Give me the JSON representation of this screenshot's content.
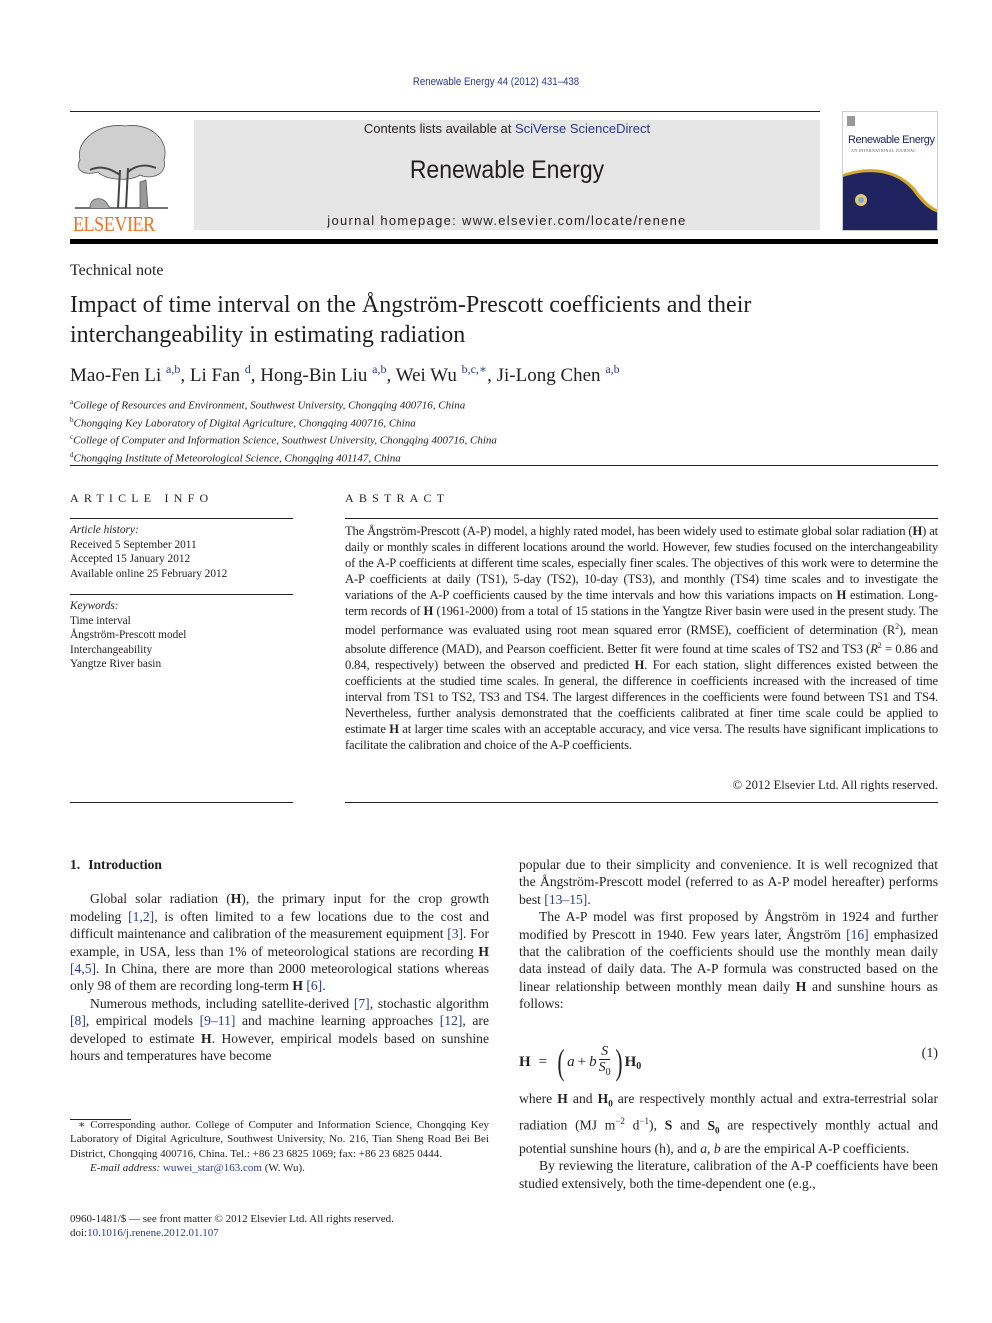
{
  "header": {
    "citation": "Renewable Energy 44 (2012) 431–438",
    "contents_prefix": "Contents lists available at ",
    "contents_link": "SciVerse ScienceDirect",
    "journal_name": "Renewable Energy",
    "homepage_prefix": "journal homepage: ",
    "homepage_url": "www.elsevier.com/locate/renene",
    "publisher_logo_text": "ELSEVIER",
    "cover_title": "Renewable Energy",
    "cover_subtitle": "AN INTERNATIONAL JOURNAL",
    "colors": {
      "publisher_orange": "#f37021",
      "link_blue": "#2b3a8c",
      "banner_gray": "#e6e6e6",
      "cover_navy": "#1f2460",
      "cover_gold": "#d4a82a"
    }
  },
  "article": {
    "section_type": "Technical note",
    "title": "Impact of time interval on the Ångström-Prescott coefficients and their interchangeability in estimating radiation",
    "authors": [
      {
        "name": "Mao-Fen Li",
        "affil": "a,b",
        "sep": ", "
      },
      {
        "name": "Li Fan",
        "affil": "d",
        "sep": ", "
      },
      {
        "name": "Hong-Bin Liu",
        "affil": "a,b",
        "sep": ", "
      },
      {
        "name": "Wei Wu",
        "affil": "b,c,∗",
        "sep": ", "
      },
      {
        "name": "Ji-Long Chen",
        "affil": "a,b",
        "sep": ""
      }
    ],
    "affiliations": [
      {
        "mark": "a",
        "text": "College of Resources and Environment, Southwest University, Chongqing 400716, China"
      },
      {
        "mark": "b",
        "text": "Chongqing Key Laboratory of Digital Agriculture, Chongqing 400716, China"
      },
      {
        "mark": "c",
        "text": "College of Computer and Information Science, Southwest University, Chongqing 400716, China"
      },
      {
        "mark": "d",
        "text": "Chongqing Institute of Meteorological Science, Chongqing 401147, China"
      }
    ]
  },
  "article_info": {
    "heading": "ARTICLE INFO",
    "history_label": "Article history:",
    "history": [
      "Received 5 September 2011",
      "Accepted 15 January 2012",
      "Available online 25 February 2012"
    ],
    "keywords_label": "Keywords:",
    "keywords": [
      "Time interval",
      "Ångström-Prescott model",
      "Interchangeability",
      "Yangtze River basin"
    ]
  },
  "abstract": {
    "heading": "ABSTRACT",
    "parts": {
      "p1": "The Ångström-Prescott (A-P) model, a highly rated model, has been widely used to estimate global solar radiation (",
      "H": "H",
      "p2": ") at daily or monthly scales in different locations around the world. However, few studies focused on the interchangeability of the A-P coefficients at different time scales, especially finer scales. The objectives of this work were to determine the A-P coefficients at daily (TS1), 5-day (TS2), 10-day (TS3), and monthly (TS4) time scales and to investigate the variations of the A-P coefficients caused by the time intervals and how this variations impacts on ",
      "p3": " estimation. Long-term records of ",
      "p4": " (1961-2000) from a total of 15 stations in the Yangtze River basin were used in the present study. The model performance was evaluated using root mean squared error (RMSE), coefficient of determination (R",
      "sup2": "2",
      "p5": "), mean absolute difference (MAD), and Pearson coefficient. Better fit were found at time scales of TS2 and TS3 (",
      "R": "R",
      "p6": " = 0.86 and 0.84, respectively) between the observed and predicted ",
      "p7": ". For each station, slight differences existed between the coefficients at the studied time scales. In general, the difference in coefficients increased with the increased of time interval from TS1 to TS2, TS3 and TS4. The largest differences in the coefficients were found between TS1 and TS4. Nevertheless, further analysis demonstrated that the coefficients calibrated at finer time scale could be applied to estimate ",
      "p8": " at larger time scales with an acceptable accuracy, and vice versa. The results have significant implications to facilitate the calibration and choice of the A-P coefficients."
    },
    "copyright": "© 2012 Elsevier Ltd. All rights reserved."
  },
  "introduction": {
    "number": "1.",
    "heading": "Introduction",
    "para1": {
      "t1": "Global solar radiation (",
      "H": "H",
      "t2": "), the primary input for the crop growth modeling ",
      "r1": "[1,2]",
      "t3": ", is often limited to a few locations due to the cost and difficult maintenance and calibration of the measurement equipment ",
      "r2": "[3]",
      "t4": ". For example, in USA, less than 1% of meteorological stations are recording ",
      "r3": "[4,5]",
      "t5": ". In China, there are more than 2000 meteorological stations whereas only 98 of them are recording long-term ",
      "r4": "[6]",
      "t6": "."
    },
    "para2": {
      "t1": "Numerous methods, including satellite-derived ",
      "r1": "[7]",
      "t2": ", stochastic algorithm ",
      "r2": "[8]",
      "t3": ", empirical models ",
      "r3": "[9–11]",
      "t4": " and machine learning approaches ",
      "r4": "[12]",
      "t5": ", are developed to estimate ",
      "t6": ". However, empirical models based on sunshine hours and temperatures have become popular due to their simplicity and convenience. It is well recognized that the Ångström-Prescott model (referred to as A-P model hereafter) performs best ",
      "r5": "[13–15]",
      "t7": "."
    },
    "para3": {
      "t1": "The A-P model was first proposed by Ångström in 1924 and further modified by Prescott in 1940. Few years later, Ångström ",
      "r1": "[16]",
      "t2": " emphasized that the calibration of the coefficients should use the monthly mean daily data instead of daily data. The A-P formula was constructed based on the linear relationship between monthly mean daily ",
      "t3": " and sunshine hours as follows:"
    },
    "equation": {
      "lhs": "H",
      "eq": "=",
      "a": "a",
      "plus": "+",
      "b": "b",
      "num": "S",
      "den": "S",
      "den_sub": "0",
      "rhs": "H",
      "rhs_sub": "0",
      "number": "(1)"
    },
    "para4": {
      "t1": "where ",
      "H": "H",
      "t2": " and ",
      "H0": "H",
      "zero": "0",
      "t3": " are respectively monthly actual and extra-terrestrial solar radiation (MJ m",
      "exp1": "−2",
      "t4": " d",
      "exp2": "−1",
      "t5": "), ",
      "S": "S",
      "t6": " and ",
      "S0": "S",
      "t7": " are respectively monthly actual and potential sunshine hours (h), and ",
      "a": "a",
      "comma": ", ",
      "b": "b",
      "t8": " are the empirical A-P coefficients."
    },
    "para5": "By reviewing the literature, calibration of the A-P coefficients have been studied extensively, both the time-dependent one (e.g.,"
  },
  "footnote": {
    "text": "∗ Corresponding author. College of Computer and Information Science, Chongqing Key Laboratory of Digital Agriculture, Southwest University, No. 216, Tian Sheng Road Bei Bei District, Chongqing 400716, China. Tel.: +86 23 6825 1069; fax: +86 23 6825 0444.",
    "email_label": "E-mail address: ",
    "email": "wuwei_star@163.com",
    "email_suffix": " (W. Wu)."
  },
  "front_matter": {
    "issn": "0960-1481/$ — see front matter © 2012 Elsevier Ltd. All rights reserved.",
    "doi_label": "doi:",
    "doi": "10.1016/j.renene.2012.01.107"
  }
}
